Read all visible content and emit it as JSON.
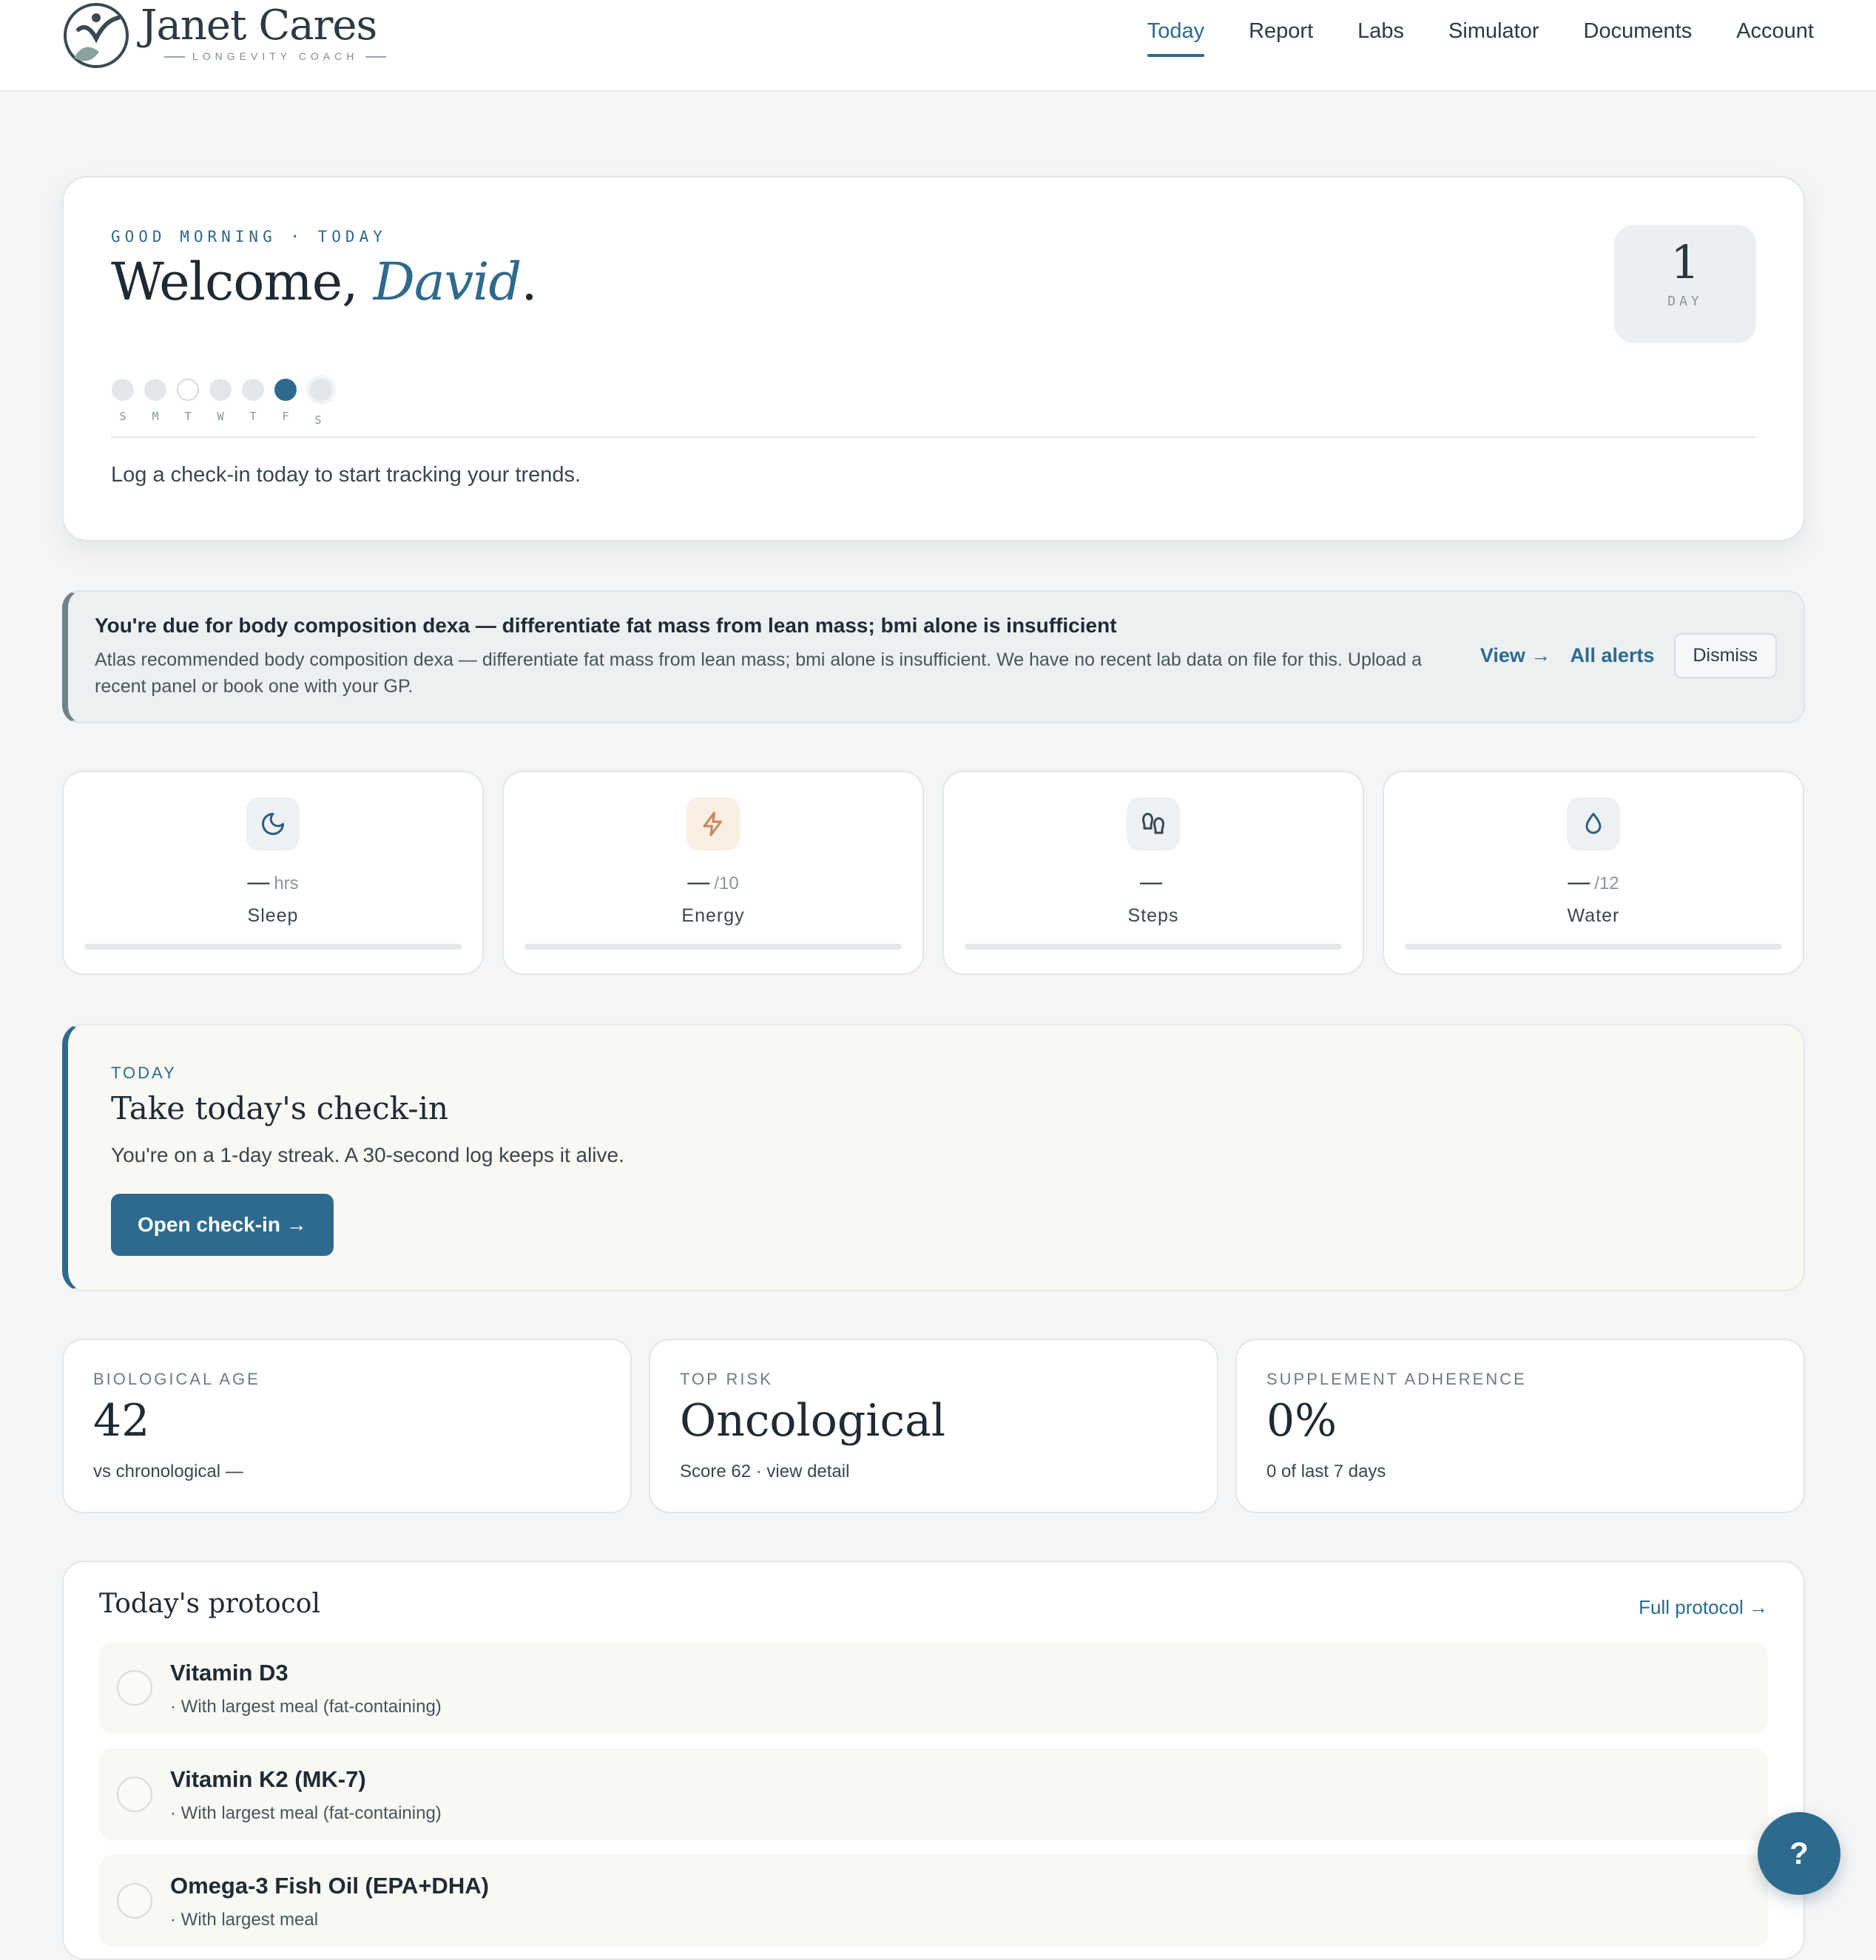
{
  "brand": {
    "name": "Janet Cares",
    "tagline": "LONGEVITY COACH"
  },
  "nav": [
    {
      "label": "Today",
      "active": true
    },
    {
      "label": "Report"
    },
    {
      "label": "Labs"
    },
    {
      "label": "Simulator"
    },
    {
      "label": "Documents"
    },
    {
      "label": "Account"
    }
  ],
  "welcome": {
    "eyebrow": "GOOD MORNING · TODAY",
    "greeting": "Welcome,",
    "name": "David",
    "punct": ".",
    "day_count": "1",
    "day_label": "DAY",
    "week_days": [
      "S",
      "M",
      "T",
      "W",
      "T",
      "F",
      "S"
    ],
    "message": "Log a check-in today to start tracking your trends."
  },
  "alert": {
    "title": "You're due for body composition dexa — differentiate fat mass from lean mass; bmi alone is insufficient",
    "body": "Atlas recommended body composition dexa — differentiate fat mass from lean mass; bmi alone is insufficient. We have no recent lab data on file for this. Upload a recent panel or book one with your GP.",
    "view_label": "View →",
    "all_label": "All alerts",
    "dismiss_label": "Dismiss"
  },
  "tiles": [
    {
      "icon": "moon-icon",
      "value": "—",
      "unit": "hrs",
      "label": "Sleep",
      "progress": 0
    },
    {
      "icon": "lightning-icon",
      "value": "—",
      "unit": "/10",
      "label": "Energy",
      "progress": 0
    },
    {
      "icon": "footprints-icon",
      "value": "—",
      "unit": "",
      "label": "Steps",
      "progress": 0
    },
    {
      "icon": "water-drop-icon",
      "value": "—",
      "unit": "/12",
      "label": "Water",
      "progress": 0
    }
  ],
  "checkin": {
    "eyebrow": "TODAY",
    "title": "Take today's check-in",
    "text": "You're on a 1-day streak. A 30-second log keeps it alive.",
    "button": "Open check-in →"
  },
  "metrics": [
    {
      "label": "BIOLOGICAL AGE",
      "value": "42",
      "sub": "vs chronological —"
    },
    {
      "label": "TOP RISK",
      "value": "Oncological",
      "sub": "Score 62 · view detail"
    },
    {
      "label": "SUPPLEMENT ADHERENCE",
      "value": "0%",
      "sub": "0 of last 7 days"
    }
  ],
  "protocol": {
    "title": "Today's protocol",
    "link": "Full protocol →",
    "items": [
      {
        "name": "Vitamin D3",
        "note": "· With largest meal (fat-containing)"
      },
      {
        "name": "Vitamin K2 (MK-7)",
        "note": "· With largest meal (fat-containing)"
      },
      {
        "name": "Omega-3 Fish Oil (EPA+DHA)",
        "note": "· With largest meal"
      }
    ]
  },
  "help_label": "?",
  "colors": {
    "accent": "#2d6a8e",
    "background": "#f4f5f6",
    "warm": "#fbeee3"
  }
}
